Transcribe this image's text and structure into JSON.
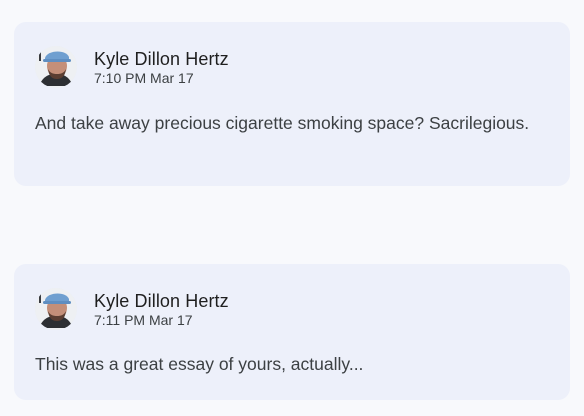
{
  "comments": [
    {
      "author": "Kyle Dillon Hertz",
      "timestamp": "7:10 PM Mar 17",
      "text": "And take away precious cigarette smoking space? Sacrilegious.",
      "avatar": "user-photo-avatar"
    },
    {
      "author": "Kyle Dillon Hertz",
      "timestamp": "7:11 PM Mar 17",
      "text": "This was a great essay of yours, actually...",
      "avatar": "user-photo-avatar"
    }
  ],
  "colors": {
    "page_background": "#f8f9fc",
    "card_background": "#edf0fa",
    "name_text": "#1f1f1f",
    "secondary_text": "#3c4043"
  }
}
